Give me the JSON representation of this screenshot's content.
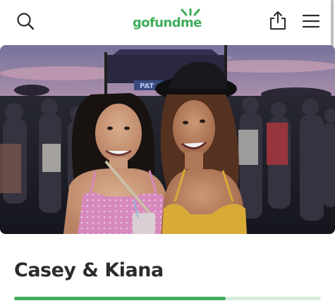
{
  "header": {
    "logo_text": "gofundme",
    "brand_color": "#3fae5a",
    "search_icon": "search-icon",
    "share_icon": "share-icon",
    "menu_icon": "hamburger-menu-icon"
  },
  "hero": {
    "image": "photo of two smiling women at an outdoor concert at sunset",
    "stage_sign": "PAT"
  },
  "campaign": {
    "title": "Casey & Kiana",
    "progress_fraction": 0.69
  }
}
